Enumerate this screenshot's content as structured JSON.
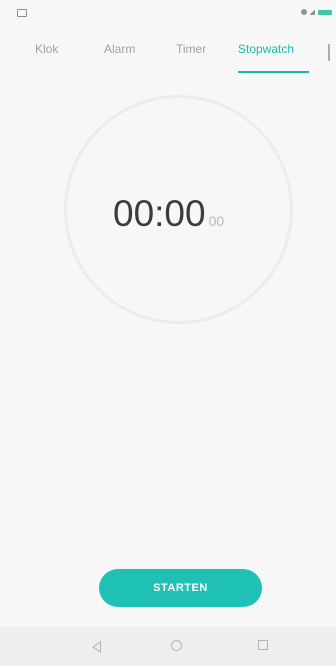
{
  "tabs": [
    {
      "label": "Klok"
    },
    {
      "label": "Alarm"
    },
    {
      "label": "Timer"
    },
    {
      "label": "Stopwatch"
    }
  ],
  "stopwatch": {
    "main": "00:00",
    "hundredths": "00"
  },
  "start_button": {
    "label": "STARTEN"
  },
  "colors": {
    "accent": "#1bb9b1",
    "button": "#1fc1b7",
    "background": "#f7f7f7"
  }
}
